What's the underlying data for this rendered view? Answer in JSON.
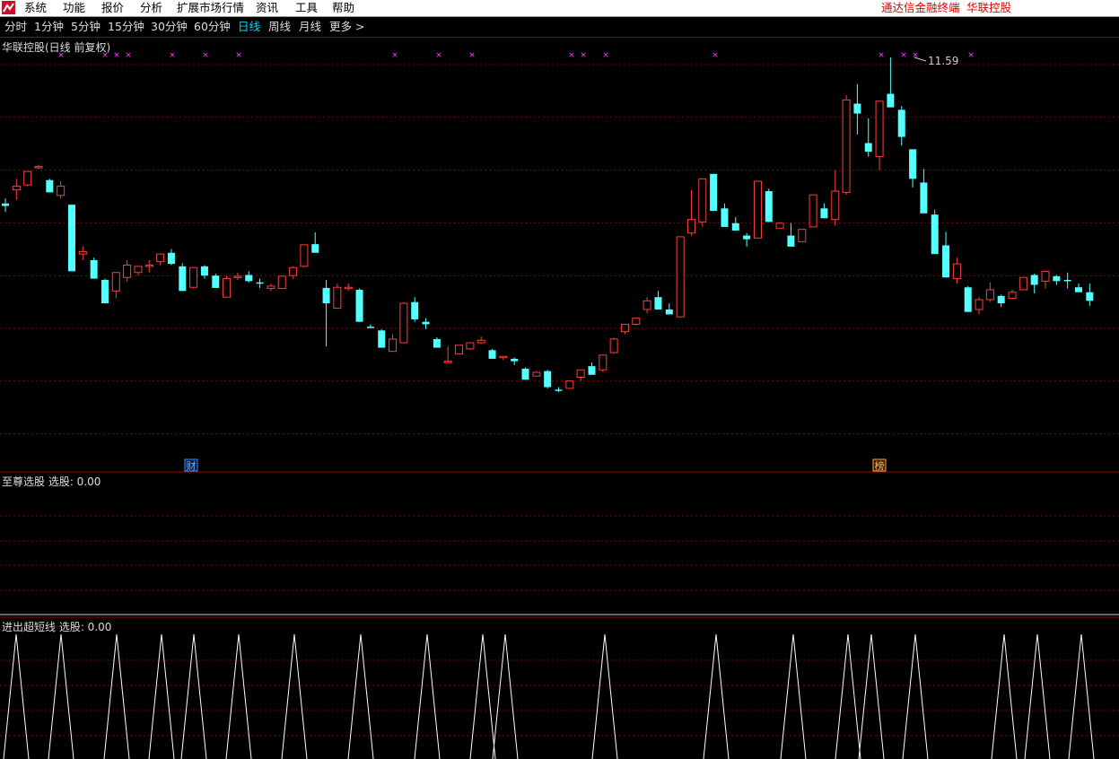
{
  "menubar": {
    "items": [
      "系统",
      "功能",
      "报价",
      "分析",
      "扩展市场行情",
      "资讯",
      "工具",
      "帮助"
    ],
    "right": [
      "通达信金融终端",
      "华联控股"
    ]
  },
  "periods": {
    "items": [
      "分时",
      "1分钟",
      "5分钟",
      "15分钟",
      "30分钟",
      "60分钟",
      "日线",
      "周线",
      "月线",
      "更多 >"
    ],
    "active": "日线"
  },
  "main_panel": {
    "title": "华联控股(日线 前复权)",
    "high_label": "11.59",
    "badges": [
      "财",
      "榜"
    ]
  },
  "indicator1": {
    "title": "至尊选股  选股: 0.00"
  },
  "indicator2": {
    "title": "进出超短线  选股: 0.00"
  },
  "colors": {
    "up": "#ff3c3c",
    "down": "#54ffff",
    "grid": "#8b0000",
    "marker": "#ff40ff",
    "badge_cai": "#3a8cff",
    "badge_bang": "#ffa040"
  },
  "chart_data": {
    "type": "candlestick",
    "note_series": "open/high/low/close values read in a relative price scale of the chart",
    "candles": [
      [
        9.22,
        9.3,
        9.08,
        9.18
      ],
      [
        9.44,
        9.62,
        9.28,
        9.5
      ],
      [
        9.52,
        9.7,
        9.5,
        9.74
      ],
      [
        9.8,
        9.85,
        9.78,
        9.82
      ],
      [
        9.6,
        9.62,
        9.42,
        9.4
      ],
      [
        9.35,
        9.58,
        9.3,
        9.5
      ],
      [
        9.2,
        9.2,
        8.6,
        8.12
      ],
      [
        8.4,
        8.52,
        8.3,
        8.44
      ],
      [
        8.3,
        8.34,
        8.0,
        8.0
      ],
      [
        7.98,
        8.0,
        7.68,
        7.6
      ],
      [
        7.8,
        8.1,
        7.68,
        8.1
      ],
      [
        8.02,
        8.3,
        7.95,
        8.22
      ],
      [
        8.1,
        8.2,
        8.05,
        8.2
      ],
      [
        8.22,
        8.3,
        8.1,
        8.22
      ],
      [
        8.28,
        8.4,
        8.22,
        8.4
      ],
      [
        8.42,
        8.48,
        8.22,
        8.24
      ],
      [
        8.2,
        8.25,
        7.8,
        7.8
      ],
      [
        7.86,
        8.18,
        7.84,
        8.18
      ],
      [
        8.2,
        8.22,
        8.0,
        8.05
      ],
      [
        8.05,
        8.08,
        7.85,
        7.85
      ],
      [
        7.7,
        8.05,
        7.7,
        8.0
      ],
      [
        8.02,
        8.1,
        7.98,
        8.04
      ],
      [
        8.06,
        8.12,
        7.94,
        7.96
      ],
      [
        7.94,
        8.0,
        7.85,
        7.92
      ],
      [
        7.84,
        7.92,
        7.8,
        7.88
      ],
      [
        7.84,
        8.05,
        7.84,
        8.04
      ],
      [
        8.05,
        8.2,
        8.0,
        8.18
      ],
      [
        8.2,
        8.55,
        8.18,
        8.55
      ],
      [
        8.56,
        8.75,
        8.46,
        8.42
      ],
      [
        7.85,
        7.98,
        6.9,
        7.6
      ],
      [
        7.52,
        7.92,
        7.6,
        7.86
      ],
      [
        7.84,
        7.92,
        7.8,
        7.86
      ],
      [
        7.82,
        7.84,
        7.3,
        7.3
      ],
      [
        7.22,
        7.26,
        7.2,
        7.2
      ],
      [
        7.16,
        7.18,
        6.88,
        6.88
      ],
      [
        6.82,
        7.1,
        6.82,
        7.02
      ],
      [
        6.96,
        7.62,
        6.96,
        7.6
      ],
      [
        7.62,
        7.7,
        7.3,
        7.34
      ],
      [
        7.3,
        7.36,
        7.18,
        7.26
      ],
      [
        7.02,
        7.05,
        6.92,
        6.88
      ],
      [
        6.66,
        6.9,
        6.66,
        6.66
      ],
      [
        6.78,
        6.9,
        6.8,
        6.92
      ],
      [
        6.86,
        6.96,
        6.84,
        6.96
      ],
      [
        6.96,
        7.06,
        6.94,
        7.0
      ],
      [
        6.84,
        6.86,
        6.72,
        6.7
      ],
      [
        6.72,
        6.74,
        6.68,
        6.74
      ],
      [
        6.7,
        6.72,
        6.6,
        6.66
      ],
      [
        6.54,
        6.56,
        6.36,
        6.36
      ],
      [
        6.42,
        6.5,
        6.44,
        6.48
      ],
      [
        6.5,
        6.52,
        6.22,
        6.24
      ],
      [
        6.2,
        6.24,
        6.16,
        6.18
      ],
      [
        6.22,
        6.3,
        6.22,
        6.34
      ],
      [
        6.4,
        6.52,
        6.34,
        6.52
      ],
      [
        6.58,
        6.64,
        6.46,
        6.44
      ],
      [
        6.52,
        6.7,
        6.48,
        6.76
      ],
      [
        6.8,
        7.04,
        6.78,
        7.02
      ],
      [
        7.14,
        7.26,
        7.1,
        7.26
      ],
      [
        7.26,
        7.36,
        7.24,
        7.36
      ],
      [
        7.5,
        7.7,
        7.44,
        7.64
      ],
      [
        7.7,
        7.8,
        7.5,
        7.5
      ],
      [
        7.5,
        7.6,
        7.46,
        7.42
      ],
      [
        7.38,
        8.68,
        7.42,
        8.68
      ],
      [
        8.74,
        9.44,
        8.7,
        8.96
      ],
      [
        8.92,
        9.62,
        8.84,
        9.62
      ],
      [
        9.7,
        9.7,
        9.1,
        9.1
      ],
      [
        9.14,
        9.22,
        8.88,
        8.84
      ],
      [
        8.9,
        9.0,
        8.8,
        8.78
      ],
      [
        8.7,
        8.74,
        8.52,
        8.64
      ],
      [
        8.66,
        9.58,
        8.72,
        9.58
      ],
      [
        9.42,
        9.46,
        8.92,
        8.92
      ],
      [
        8.82,
        8.92,
        8.88,
        8.9
      ],
      [
        8.7,
        8.9,
        8.56,
        8.52
      ],
      [
        8.6,
        8.66,
        8.66,
        8.8
      ],
      [
        8.84,
        9.26,
        8.84,
        9.36
      ],
      [
        9.14,
        9.22,
        8.98,
        8.98
      ],
      [
        8.96,
        9.76,
        8.86,
        9.42
      ],
      [
        9.4,
        10.98,
        9.36,
        10.9
      ],
      [
        10.84,
        11.16,
        10.34,
        10.68
      ],
      [
        10.2,
        10.6,
        9.98,
        10.06
      ],
      [
        9.98,
        10.62,
        9.76,
        10.88
      ],
      [
        11.0,
        11.59,
        10.94,
        10.78
      ],
      [
        10.74,
        10.8,
        10.16,
        10.3
      ],
      [
        10.1,
        10.08,
        9.48,
        9.62
      ],
      [
        9.56,
        9.78,
        9.22,
        9.06
      ],
      [
        9.04,
        9.12,
        8.46,
        8.4
      ],
      [
        8.54,
        8.76,
        8.02,
        8.02
      ],
      [
        8.0,
        8.34,
        7.92,
        8.24
      ],
      [
        7.86,
        7.88,
        7.46,
        7.46
      ],
      [
        7.5,
        7.7,
        7.42,
        7.66
      ],
      [
        7.66,
        7.94,
        7.62,
        7.82
      ],
      [
        7.72,
        7.74,
        7.54,
        7.6
      ],
      [
        7.68,
        7.82,
        7.68,
        7.78
      ],
      [
        7.82,
        8.0,
        7.88,
        8.02
      ],
      [
        8.06,
        8.08,
        7.76,
        7.9
      ],
      [
        7.96,
        8.12,
        7.84,
        8.12
      ],
      [
        8.04,
        8.06,
        7.9,
        7.96
      ],
      [
        7.98,
        8.1,
        7.84,
        7.96
      ],
      [
        7.86,
        7.92,
        7.8,
        7.78
      ],
      [
        7.78,
        7.92,
        7.56,
        7.64
      ]
    ],
    "marker_x": [
      68,
      117,
      130,
      143,
      192,
      229,
      266,
      440,
      489,
      526,
      637,
      650,
      675,
      797,
      982,
      1007,
      1020,
      1082
    ],
    "indicator2_peaks": [
      18,
      68,
      130,
      180,
      216,
      266,
      328,
      402,
      476,
      538,
      563,
      674,
      798,
      884,
      945,
      971,
      1020,
      1119,
      1156,
      1205
    ]
  }
}
